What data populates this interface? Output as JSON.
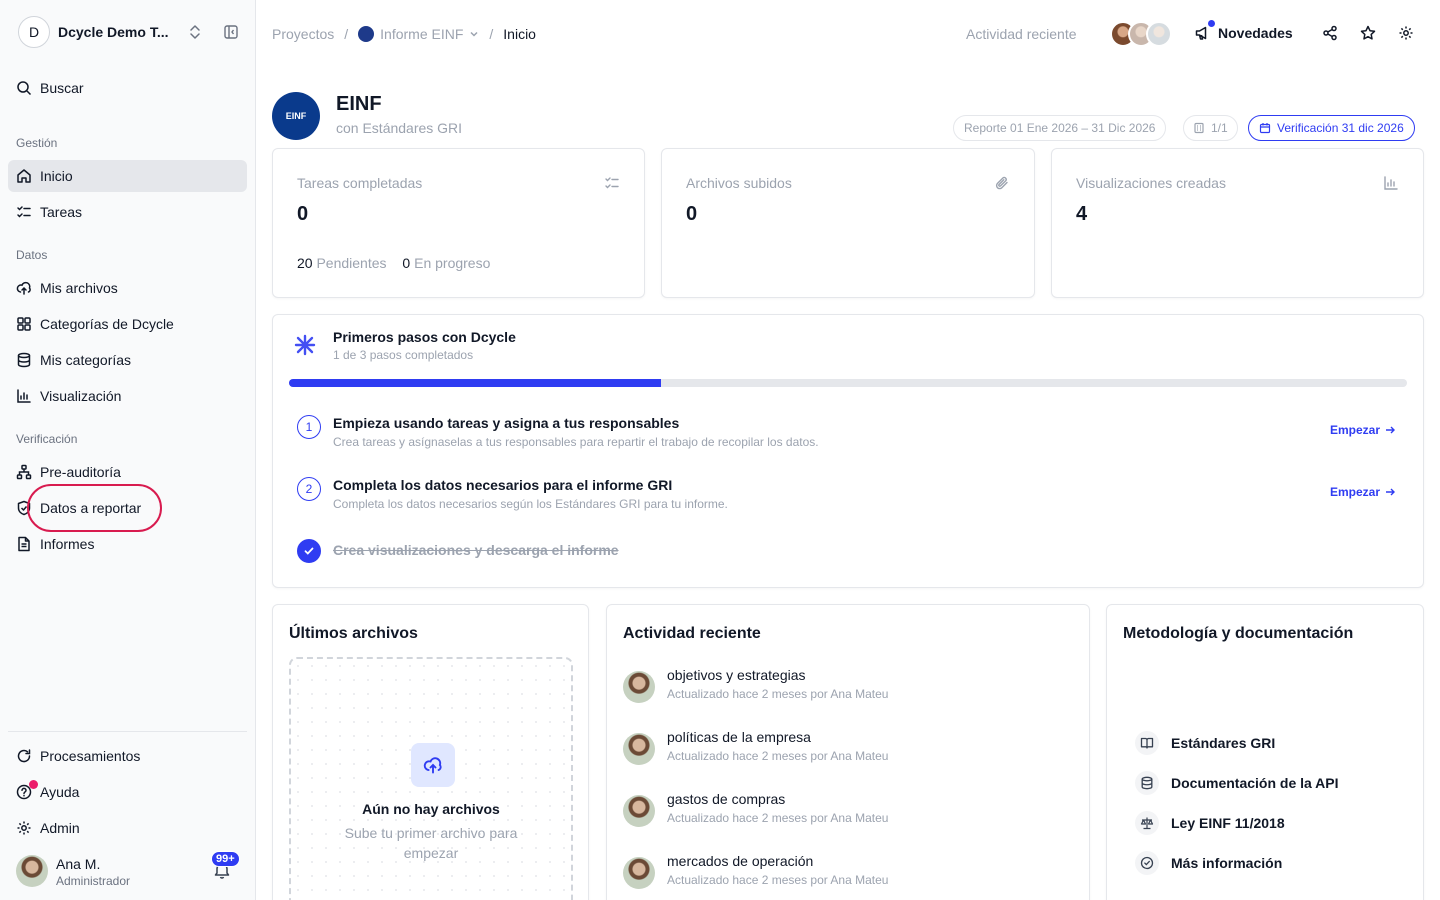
{
  "workspace": {
    "initial": "D",
    "name": "Dcycle Demo T..."
  },
  "sidebar": {
    "search": "Buscar",
    "sections": {
      "gestion": "Gestión",
      "datos": "Datos",
      "verificacion": "Verificación"
    },
    "items": {
      "inicio": "Inicio",
      "tareas": "Tareas",
      "mis_archivos": "Mis archivos",
      "categorias_dcycle": "Categorías de Dcycle",
      "mis_categorias": "Mis categorías",
      "visualizacion": "Visualización",
      "pre_auditoria": "Pre-auditoría",
      "datos_reportar": "Datos a reportar",
      "informes": "Informes"
    },
    "bottom": {
      "procesamientos": "Procesamientos",
      "ayuda": "Ayuda",
      "admin": "Admin"
    },
    "user": {
      "name": "Ana M.",
      "role": "Administrador",
      "notifications": "99+"
    }
  },
  "topbar": {
    "crumbs": {
      "proyectos": "Proyectos",
      "informe": "Informe EINF",
      "current": "Inicio"
    },
    "activity": "Actividad reciente",
    "novedades": "Novedades"
  },
  "project": {
    "logo_text": "EINF",
    "title": "EINF",
    "subtitle": "con Estándares GRI",
    "period": "Reporte 01 Ene 2026 – 31 Dic 2026",
    "count": "1/1",
    "verification": "Verificación 31 dic 2026"
  },
  "stats": {
    "tareas": {
      "label": "Tareas completadas",
      "value": "0",
      "pending_value": "20",
      "pending_label": "Pendientes",
      "progress_value": "0",
      "progress_label": "En progreso"
    },
    "archivos": {
      "label": "Archivos subidos",
      "value": "0"
    },
    "visualizaciones": {
      "label": "Visualizaciones creadas",
      "value": "4"
    }
  },
  "onboarding": {
    "title": "Primeros pasos con Dcycle",
    "subtitle": "1 de 3 pasos completados",
    "progress": 0.333,
    "steps": [
      {
        "num": "1",
        "title": "Empieza usando tareas y asigna a tus responsables",
        "desc": "Crea tareas y asígnaselas a tus responsables para repartir el trabajo de recopilar los datos.",
        "cta": "Empezar"
      },
      {
        "num": "2",
        "title": "Completa los datos necesarios para el informe GRI",
        "desc": "Completa los datos necesarios según los Estándares GRI para tu informe.",
        "cta": "Empezar"
      },
      {
        "title": "Crea visualizaciones y descarga el informe"
      }
    ]
  },
  "files_card": {
    "title": "Últimos archivos",
    "empty_title": "Aún no hay archivos",
    "empty_sub": "Sube tu primer archivo para empezar"
  },
  "activity_card": {
    "title": "Actividad reciente",
    "items": [
      {
        "title": "objetivos y estrategias",
        "sub": "Actualizado hace 2 meses por Ana Mateu"
      },
      {
        "title": "políticas de la empresa",
        "sub": "Actualizado hace 2 meses por Ana Mateu"
      },
      {
        "title": "gastos de compras",
        "sub": "Actualizado hace 2 meses por Ana Mateu"
      },
      {
        "title": "mercados de operación",
        "sub": "Actualizado hace 2 meses por Ana Mateu"
      }
    ]
  },
  "docs_card": {
    "title": "Metodología y documentación",
    "items": [
      {
        "label": "Estándares GRI",
        "icon": "book-icon"
      },
      {
        "label": "Documentación de la API",
        "icon": "database-icon"
      },
      {
        "label": "Ley EINF 11/2018",
        "icon": "scale-icon"
      },
      {
        "label": "Más información",
        "icon": "check-circle-icon"
      }
    ]
  },
  "colors": {
    "accent": "#2f3cf2",
    "highlight": "#d81b4f"
  }
}
